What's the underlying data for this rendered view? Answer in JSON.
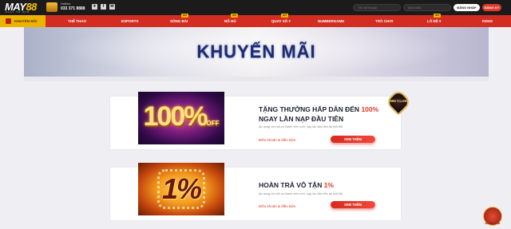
{
  "header": {
    "logo": {
      "brand": "MAY88",
      "brand_prefix": "MAY",
      "brand_suffix": "88",
      "tagline": "PLAY TO WIN"
    },
    "hotline": {
      "label": "Hotline",
      "number": "033 371 8888"
    },
    "social": [
      {
        "icon": "telegram-icon",
        "glyph": "✈"
      },
      {
        "icon": "facebook-icon",
        "glyph": "f"
      },
      {
        "icon": "messenger-icon",
        "glyph": "✉"
      }
    ],
    "username_placeholder": "Tên tài khoản",
    "password_placeholder": "Mật khẩu",
    "login_label": "ĐĂNG NHẬP",
    "register_label": "ĐĂNG KÝ"
  },
  "nav": {
    "items": [
      {
        "label": "KHUYẾN MÃI",
        "active": true
      },
      {
        "label": "THỂ THAO"
      },
      {
        "label": "ESPORTS"
      },
      {
        "label": "SÒNG BÀI",
        "badge": "HOT"
      },
      {
        "label": "NỔ HŨ",
        "badge": "HOT"
      },
      {
        "label": "QUAY SỐ ▾",
        "badge": "HOT"
      },
      {
        "label": "NUMBERGAME"
      },
      {
        "label": "TRÒ CHƠI"
      },
      {
        "label": "LÔ ĐỀ ▾",
        "badge": "HOT"
      },
      {
        "label": "KENO"
      }
    ]
  },
  "banner": {
    "title": "KHUYẾN MÃI"
  },
  "promos": [
    {
      "image_text": "100%",
      "image_sub": "OFF",
      "title_line1": "TẶNG THƯỞNG HẤP DẪN ĐẾN ",
      "title_highlight": "100%",
      "title_line2": "NGAY LẦN NẠP ĐẦU TIÊN",
      "description": "Áp dụng cho tất cả thành viên mới, nạp lần đầu tiên tại MAY88",
      "terms": "Điều khoản & điều kiện",
      "button": "XEM THÊM"
    },
    {
      "image_text": "1%",
      "title_line1": "HOÀN TRẢ VÔ TẬN ",
      "title_highlight": "1%",
      "description": "Áp dụng cho tất cả thành viên mới, nạp lần đầu tiên tại MAY88",
      "terms": "Điều khoản & điều kiện",
      "button": "XEM THÊM"
    }
  ],
  "badge": {
    "text": "888 CLUB"
  },
  "float": {
    "label": "MAY88 CLUB"
  },
  "colors": {
    "nav_red": "#d32d22",
    "active_yellow": "#ecb400",
    "accent_red": "#e03a2a",
    "banner_title": "#1f2b6b"
  }
}
